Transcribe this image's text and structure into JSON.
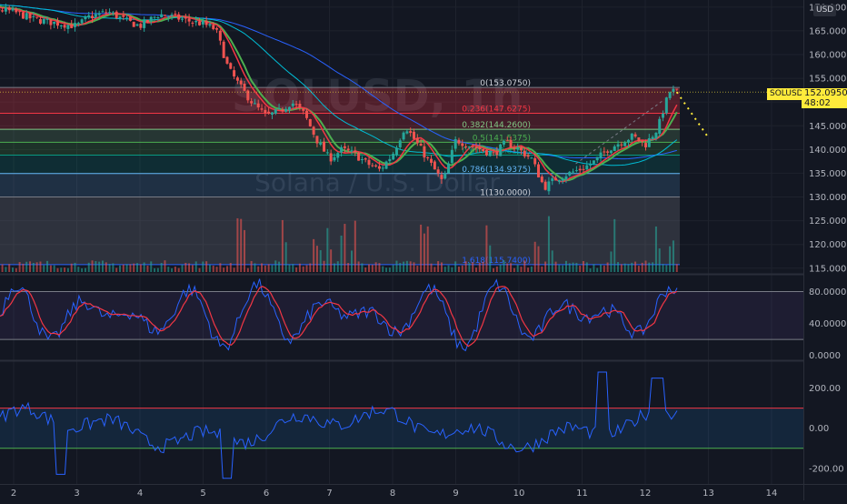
{
  "app": {
    "currency": "USD",
    "symbol_tag": "SOLUSD",
    "last_price": "152.0950",
    "countdown": "48:02",
    "watermark_line1": "SOLUSD, 1h",
    "watermark_line2": "Solana / U.S. Dollar"
  },
  "colors": {
    "background": "#131722",
    "bull": "#26a69a",
    "bear": "#ef5350",
    "price_tag": "#ffeb3b",
    "rsi_fast": "#2962ff",
    "rsi_slow": "#f23645",
    "cci": "#2962ff"
  },
  "chart_data": [
    {
      "type": "candlestick",
      "pane": "price",
      "y_ticks": [
        "170.0000",
        "165.0000",
        "160.0000",
        "155.0000",
        "150.0000",
        "145.0000",
        "140.0000",
        "135.0000",
        "130.0000",
        "125.0000",
        "120.0000",
        "115.0000"
      ],
      "x_ticks": [
        "2",
        "3",
        "4",
        "5",
        "6",
        "7",
        "8",
        "9",
        "10",
        "11",
        "12",
        "13",
        "14"
      ],
      "ylim": [
        114,
        171.5
      ],
      "fibonacci": [
        {
          "label": "0(153.0750)",
          "value": 153.075
        },
        {
          "label": "0.236(147.6275)",
          "value": 147.6275
        },
        {
          "label": "0.382(144.2600)",
          "value": 144.26
        },
        {
          "label": "0.5(141.5375)",
          "value": 141.5375
        },
        {
          "label": "0.618(138.8150)",
          "value": 138.815
        },
        {
          "label": "0.786(134.9375)",
          "value": 134.9375
        },
        {
          "label": "1(130.0000)",
          "value": 130.0
        },
        {
          "label": "1.618(115.7400)",
          "value": 115.74
        }
      ],
      "close_path": [
        [
          1.0,
          171
        ],
        [
          1.5,
          170
        ],
        [
          2.0,
          169
        ],
        [
          2.3,
          167.5
        ],
        [
          2.6,
          166.8
        ],
        [
          3.0,
          166
        ],
        [
          3.2,
          168
        ],
        [
          3.5,
          169
        ],
        [
          3.8,
          167
        ],
        [
          4.0,
          166
        ],
        [
          4.3,
          168.5
        ],
        [
          4.5,
          168
        ],
        [
          4.8,
          167
        ],
        [
          5.0,
          166.5
        ],
        [
          5.2,
          165.3
        ],
        [
          5.4,
          157
        ],
        [
          5.6,
          153
        ],
        [
          5.8,
          149.5
        ],
        [
          6.0,
          147
        ],
        [
          6.2,
          148
        ],
        [
          6.4,
          150
        ],
        [
          6.6,
          147.5
        ],
        [
          6.8,
          142
        ],
        [
          7.0,
          138
        ],
        [
          7.2,
          140
        ],
        [
          7.4,
          139
        ],
        [
          7.6,
          137
        ],
        [
          7.8,
          135.7
        ],
        [
          8.0,
          139
        ],
        [
          8.2,
          145
        ],
        [
          8.4,
          141
        ],
        [
          8.6,
          137
        ],
        [
          8.8,
          133
        ],
        [
          9.0,
          142
        ],
        [
          9.2,
          141
        ],
        [
          9.4,
          140
        ],
        [
          9.6,
          139
        ],
        [
          9.8,
          141.5
        ],
        [
          10.0,
          140
        ],
        [
          10.2,
          138
        ],
        [
          10.4,
          132
        ],
        [
          10.6,
          134
        ],
        [
          10.8,
          135
        ],
        [
          11.0,
          136
        ],
        [
          11.2,
          137.5
        ],
        [
          11.4,
          140
        ],
        [
          11.6,
          141.5
        ],
        [
          11.8,
          142.8
        ],
        [
          12.0,
          141
        ],
        [
          12.2,
          144.5
        ],
        [
          12.3,
          149
        ],
        [
          12.4,
          152.5
        ],
        [
          12.5,
          152.1
        ]
      ],
      "volume_spikes": [
        5.6,
        6.3,
        6.8,
        7.0,
        7.2,
        7.4,
        8.5,
        9.5,
        10.3,
        10.5,
        11.5,
        12.2,
        12.4
      ],
      "projection": [
        [
          12.5,
          152.1
        ],
        [
          13.0,
          142.5
        ]
      ]
    },
    {
      "type": "line",
      "pane": "stoch_rsi",
      "y_ticks": [
        "80.0000",
        "40.0000",
        "0.0000"
      ],
      "ylim": [
        -5,
        100
      ],
      "bands": [
        80,
        20
      ]
    },
    {
      "type": "line",
      "pane": "cci",
      "y_ticks": [
        "200.00",
        "0.00",
        "-200.00"
      ],
      "ylim": [
        -260,
        330
      ],
      "bands": [
        100,
        -100
      ]
    }
  ]
}
